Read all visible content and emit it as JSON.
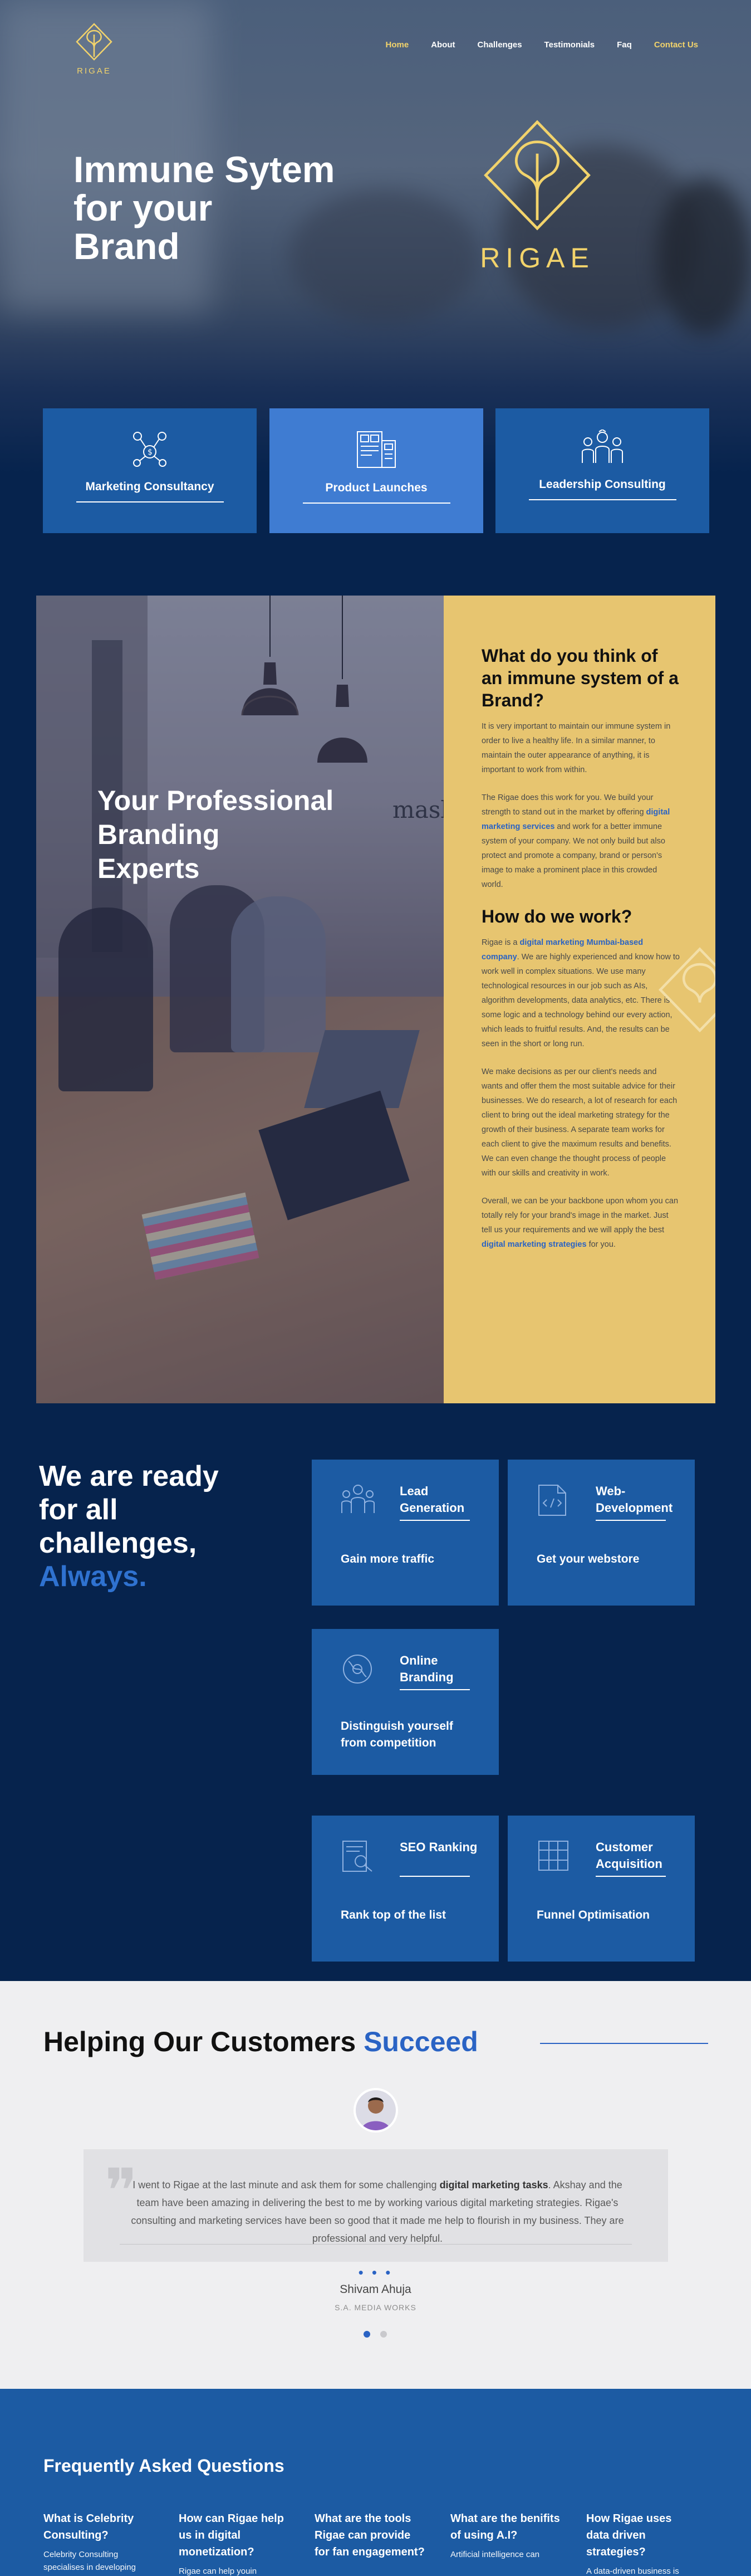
{
  "colors": {
    "accent_gold": "#f2d36b",
    "navy": "#06234d",
    "blue": "#1c5ba3",
    "light_blue": "#3f7cd2",
    "link_blue": "#2a63c4",
    "yellow_panel": "#e7c570"
  },
  "nav": {
    "logo_text": "RIGAE",
    "items": [
      {
        "label": "Home",
        "active": true
      },
      {
        "label": "About"
      },
      {
        "label": "Challenges"
      },
      {
        "label": "Testimonials"
      },
      {
        "label": "Faq"
      },
      {
        "label": "Contact Us",
        "accent": true
      }
    ]
  },
  "hero": {
    "title_line1": "Immune Sytem",
    "title_line2": "for your",
    "title_line3": "Brand",
    "logo_text": "RIGAE"
  },
  "services": [
    {
      "label": "Marketing Consultancy",
      "icon": "network-dollar-icon"
    },
    {
      "label": "Product Launches",
      "icon": "product-launch-icon"
    },
    {
      "label": "Leadership Consulting",
      "icon": "team-leaders-icon"
    }
  ],
  "about": {
    "photo_title_line1": "Your Professional",
    "photo_title_line2": "Branding",
    "photo_title_line3": "Experts",
    "h1": "What do you think of an immune system of a Brand?",
    "p1": "It is very important to maintain our immune system in order to live a healthy life. In a similar manner, to maintain the outer appearance of anything, it is important to work from within.",
    "p2_a": "The Rigae does this work for you. We build your strength to stand out in the market by offering ",
    "p2_link": "digital marketing services",
    "p2_b": " and work for a better immune system of your company. We not only build but also protect and promote a company, brand or person's image to make a prominent place in this crowded world.",
    "h2": "How do we work?",
    "p3_a": "Rigae is a ",
    "p3_link": "digital marketing Mumbai-based company",
    "p3_b": ". We are highly experienced and know how to work well in complex situations. We use many technological resources in our job such as AIs, algorithm developments, data analytics, etc. There is some logic and a technology behind our every action, which leads to fruitful results. And, the results can be seen in the short or long run.",
    "p4": "We make decisions as per our client's needs and wants and offer them the most suitable advice for their businesses. We do research, a lot of research for each client to bring out the ideal marketing strategy for the growth of their business. A separate team works for each client to give the maximum results and benefits. We can even change the thought process of people with our skills and creativity in work.",
    "p5_a": "Overall, we can be your backbone upon whom you can totally rely for your brand's image in the market. Just tell us your requirements and we will apply the best ",
    "p5_link": "digital marketing strategies",
    "p5_b": " for you."
  },
  "ready": {
    "line1": "We are ready",
    "line2": "for all",
    "line3": "challenges,",
    "line4": "Always."
  },
  "cards": [
    {
      "title": "Lead Generation",
      "subtitle": "Gain more traffic",
      "icon": "lead-generation-icon"
    },
    {
      "title": "Web-Development",
      "subtitle": "Get your webstore",
      "icon": "web-development-icon"
    },
    {
      "title": "Online Branding",
      "subtitle": "Distinguish yourself from competition",
      "icon": "online-branding-icon"
    },
    {
      "title": "SEO Ranking",
      "subtitle": "Rank top of the list",
      "icon": "seo-ranking-icon"
    },
    {
      "title": "Customer Acquisition",
      "subtitle": "Funnel Optimisation",
      "icon": "customer-acquisition-icon"
    }
  ],
  "testimonials": {
    "title_a": "Helping Our Customers ",
    "title_b": "Succeed",
    "quote_a": "I went to Rigae at the last minute and ask them for some challenging ",
    "quote_bold": "digital marketing tasks",
    "quote_b": ". Akshay and the team have been amazing in delivering the best to me by working various digital marketing strategies. Rigae's consulting and marketing services have been so good that it made me help to flourish in my business. They are professional and very helpful.",
    "name": "Shivam Ahuja",
    "company": "S.A. MEDIA WORKS",
    "dots": "• • •",
    "active_page": 1,
    "pages": 2
  },
  "faq": {
    "title": "Frequently Asked Questions",
    "items": [
      {
        "q": "What is Celebrity Consulting?",
        "a": "Celebrity Consulting specialises in developing"
      },
      {
        "q": "How can Rigae help us in digital monetization?",
        "a": "Rigae can help youin"
      },
      {
        "q": "What are the tools Rigae can provide for fan engagement?",
        "a": ""
      },
      {
        "q": "What are the benifits of using A.I?",
        "a": "Artificial intelligence can"
      },
      {
        "q": "How Rigae uses data driven strategies?",
        "a": "A data-driven business is"
      }
    ]
  }
}
